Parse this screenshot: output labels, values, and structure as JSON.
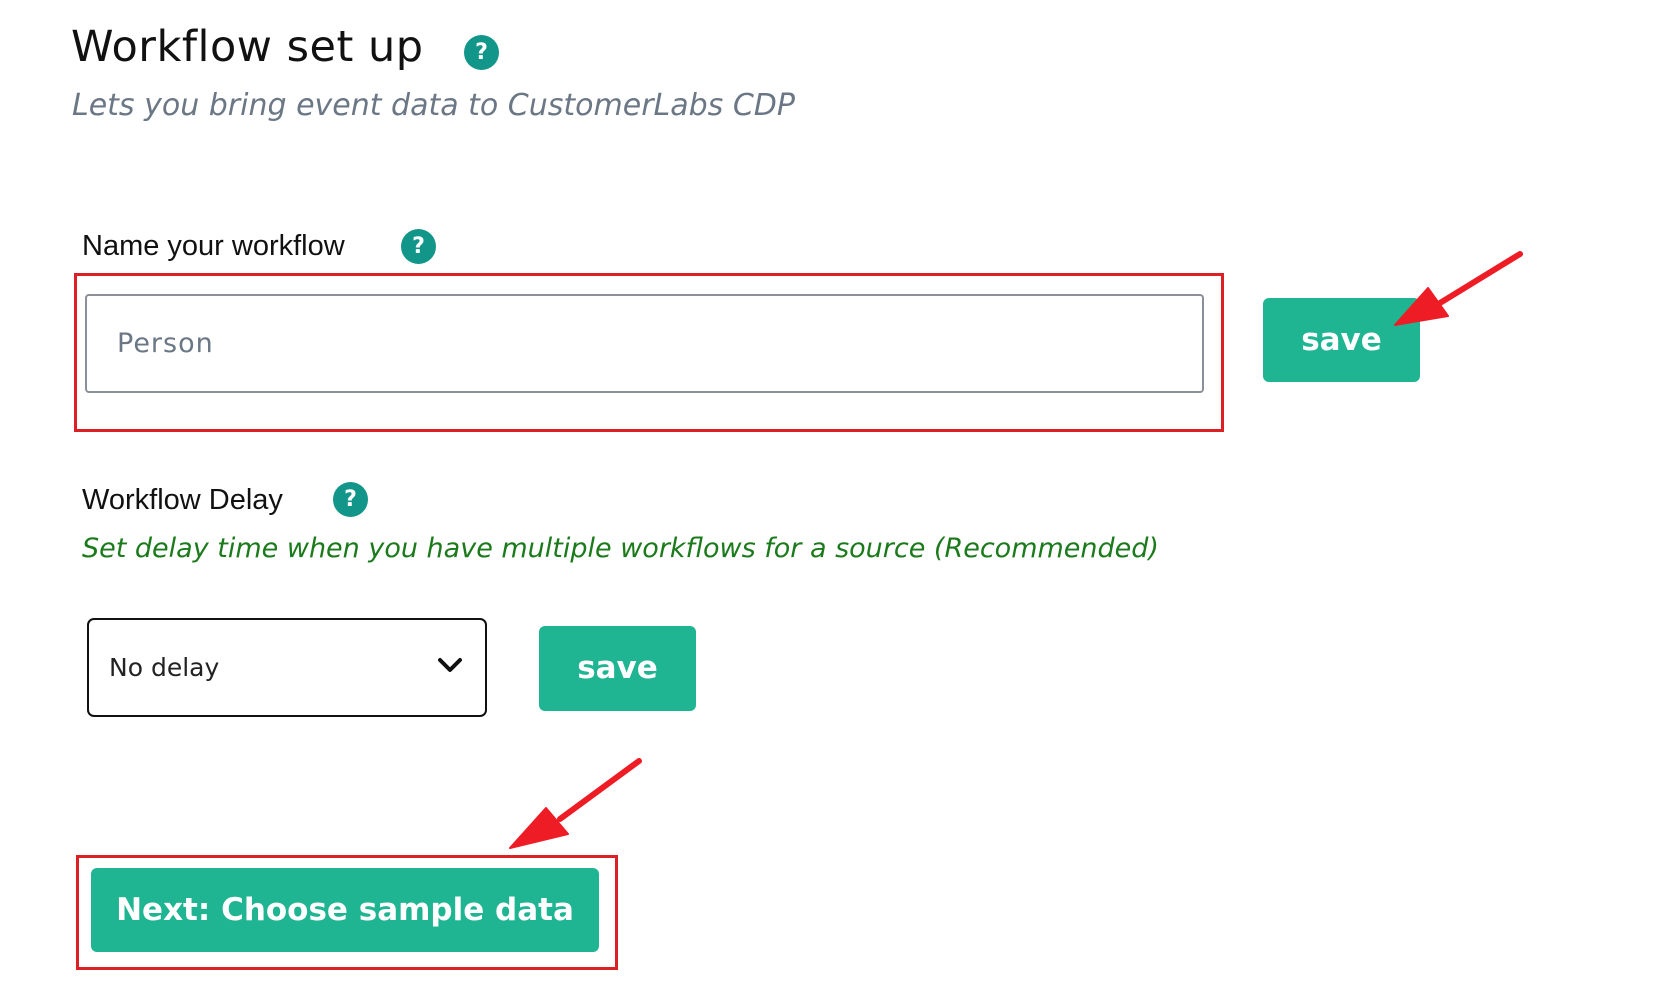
{
  "header": {
    "title": "Workflow set up",
    "subtitle": "Lets you bring event data to CustomerLabs CDP",
    "help_glyph": "?"
  },
  "name_section": {
    "label": "Name your workflow",
    "help_glyph": "?",
    "input_placeholder": "Person",
    "input_value": "",
    "save_label": "save"
  },
  "delay_section": {
    "label": "Workflow Delay",
    "help_glyph": "?",
    "help_text": "Set delay time when you have multiple workflows for a source (Recommended)",
    "selected_option": "No delay",
    "save_label": "save"
  },
  "footer": {
    "next_label": "Next: Choose sample data"
  },
  "colors": {
    "accent": "#20b592",
    "help_icon": "#12968a",
    "annotation": "#dd1f26",
    "help_text": "#1b7a1b",
    "subtitle": "#6b7785"
  },
  "icons": [
    "help-icon",
    "chevron-down-icon",
    "annotation-arrow"
  ]
}
